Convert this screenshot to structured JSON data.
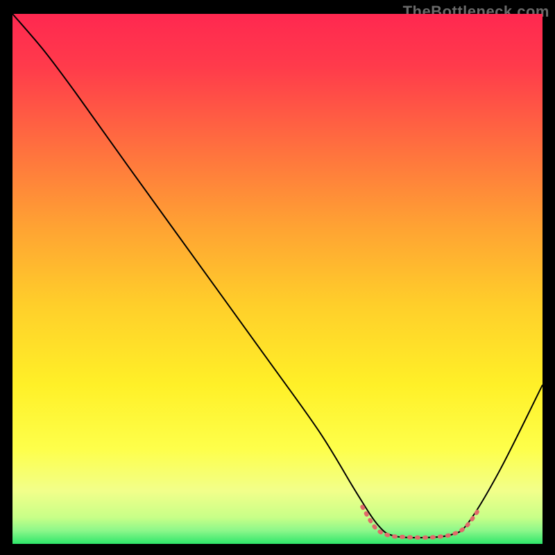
{
  "watermark": "TheBottleneck.com",
  "chart_data": {
    "type": "line",
    "title": "",
    "xlabel": "",
    "ylabel": "",
    "xlim": [
      0,
      100
    ],
    "ylim": [
      0,
      100
    ],
    "grid": false,
    "legend": false,
    "background_gradient": {
      "type": "vertical",
      "stops": [
        {
          "offset": 0.0,
          "color": "#ff2850"
        },
        {
          "offset": 0.1,
          "color": "#ff3b4b"
        },
        {
          "offset": 0.25,
          "color": "#ff6f3f"
        },
        {
          "offset": 0.4,
          "color": "#ffa233"
        },
        {
          "offset": 0.55,
          "color": "#ffcf2a"
        },
        {
          "offset": 0.7,
          "color": "#fff028"
        },
        {
          "offset": 0.82,
          "color": "#feff4a"
        },
        {
          "offset": 0.9,
          "color": "#f2ff8a"
        },
        {
          "offset": 0.95,
          "color": "#c8ff88"
        },
        {
          "offset": 0.975,
          "color": "#8cf78a"
        },
        {
          "offset": 1.0,
          "color": "#2ee66a"
        }
      ]
    },
    "series": [
      {
        "name": "curve",
        "stroke": "#000000",
        "stroke_width": 2,
        "points": [
          {
            "x": 0.0,
            "y": 100.0
          },
          {
            "x": 6.0,
            "y": 93.0
          },
          {
            "x": 12.0,
            "y": 85.0
          },
          {
            "x": 22.0,
            "y": 71.0
          },
          {
            "x": 35.0,
            "y": 53.0
          },
          {
            "x": 48.0,
            "y": 35.0
          },
          {
            "x": 58.0,
            "y": 21.0
          },
          {
            "x": 65.0,
            "y": 9.5
          },
          {
            "x": 69.0,
            "y": 3.5
          },
          {
            "x": 72.0,
            "y": 1.5
          },
          {
            "x": 78.0,
            "y": 1.2
          },
          {
            "x": 83.0,
            "y": 1.8
          },
          {
            "x": 86.0,
            "y": 4.0
          },
          {
            "x": 92.0,
            "y": 14.0
          },
          {
            "x": 100.0,
            "y": 30.0
          }
        ]
      },
      {
        "name": "marker-band",
        "stroke": "#e06a6a",
        "stroke_width": 6,
        "dash": "1.2 5.5",
        "linecap": "round",
        "points": [
          {
            "x": 66.0,
            "y": 7.0
          },
          {
            "x": 68.5,
            "y": 3.0
          },
          {
            "x": 71.0,
            "y": 1.6
          },
          {
            "x": 74.0,
            "y": 1.3
          },
          {
            "x": 77.0,
            "y": 1.2
          },
          {
            "x": 80.0,
            "y": 1.3
          },
          {
            "x": 83.0,
            "y": 1.8
          },
          {
            "x": 85.5,
            "y": 3.2
          },
          {
            "x": 88.0,
            "y": 6.5
          }
        ]
      }
    ]
  }
}
